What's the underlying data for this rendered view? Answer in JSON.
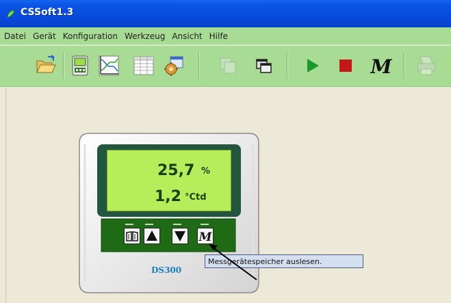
{
  "window": {
    "title": "CSSoft1.3"
  },
  "menu": [
    "Datei",
    "Gerät",
    "Konfiguration",
    "Werkzeug",
    "Ansicht",
    "Hilfe"
  ],
  "toolbar": {
    "buttons": [
      {
        "icon": "open-folder-icon",
        "enabled": true
      },
      {
        "icon": "device-icon",
        "enabled": true
      },
      {
        "icon": "line-chart-icon",
        "enabled": true
      },
      {
        "icon": "table-icon",
        "enabled": true
      },
      {
        "icon": "settings-icon",
        "enabled": true
      },
      {
        "icon": "copy-icon",
        "enabled": false
      },
      {
        "icon": "windows-icon",
        "enabled": true
      },
      {
        "icon": "play-icon",
        "enabled": true
      },
      {
        "icon": "stop-icon",
        "enabled": true
      },
      {
        "icon": "memory-icon",
        "enabled": true
      },
      {
        "icon": "printer-icon",
        "enabled": false
      }
    ],
    "memory_glyph": "M"
  },
  "device": {
    "model": "DS300",
    "readings": [
      {
        "value": "25,7",
        "unit": "%"
      },
      {
        "value": "1,2",
        "unit": "°Ctd"
      }
    ],
    "buttons": [
      "book-icon",
      "arrow-up-icon",
      "arrow-down-icon",
      "memory-icon"
    ],
    "memory_glyph": "M"
  },
  "tooltip": {
    "text": "Messgerätespeicher auslesen."
  },
  "colors": {
    "titlebar": "#0a54e6",
    "toolbar": "#a8dc94",
    "lcd": "#b5ee5a",
    "lcd_frame": "#23563f",
    "device_keypad": "#1f6b15",
    "model_label": "#1a7cc0",
    "tooltip": "#d4dff0"
  }
}
